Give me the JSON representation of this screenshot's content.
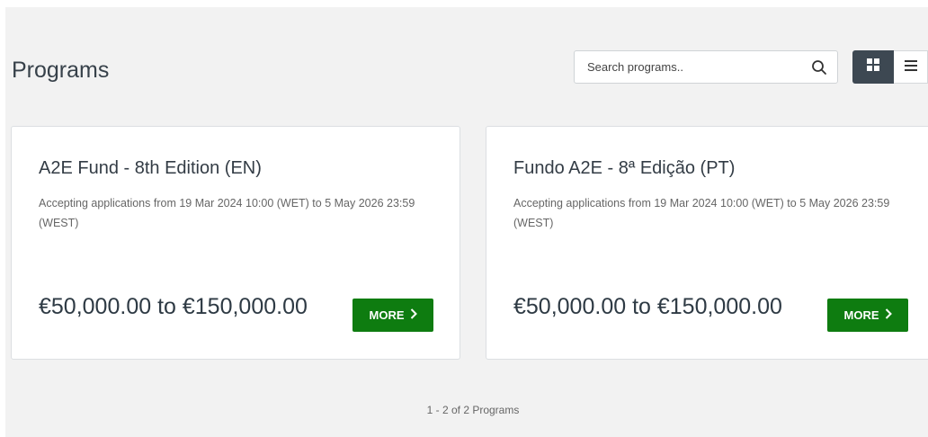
{
  "header": {
    "title": "Programs",
    "search": {
      "placeholder": "Search programs.."
    },
    "view_modes": [
      "grid-view",
      "list-view"
    ],
    "active_view": "grid-view"
  },
  "programs": [
    {
      "title": "A2E Fund - 8th Edition (EN)",
      "description": "Accepting applications from 19 Mar 2024 10:00 (WET) to 5 May 2026 23:59 (WEST)",
      "amount": "€50,000.00 to €150,000.00",
      "button_label": "MORE"
    },
    {
      "title": "Fundo A2E - 8ª Edição (PT)",
      "description": "Accepting applications from 19 Mar 2024 10:00 (WET) to 5 May 2026 23:59 (WEST)",
      "amount": "€50,000.00 to €150,000.00",
      "button_label": "MORE"
    }
  ],
  "pagination": {
    "summary": "1 - 2 of 2 Programs"
  },
  "colors": {
    "accent_button": "#0e7c10",
    "toggle_active": "#3d4852",
    "page_background": "#f2f2f2"
  }
}
